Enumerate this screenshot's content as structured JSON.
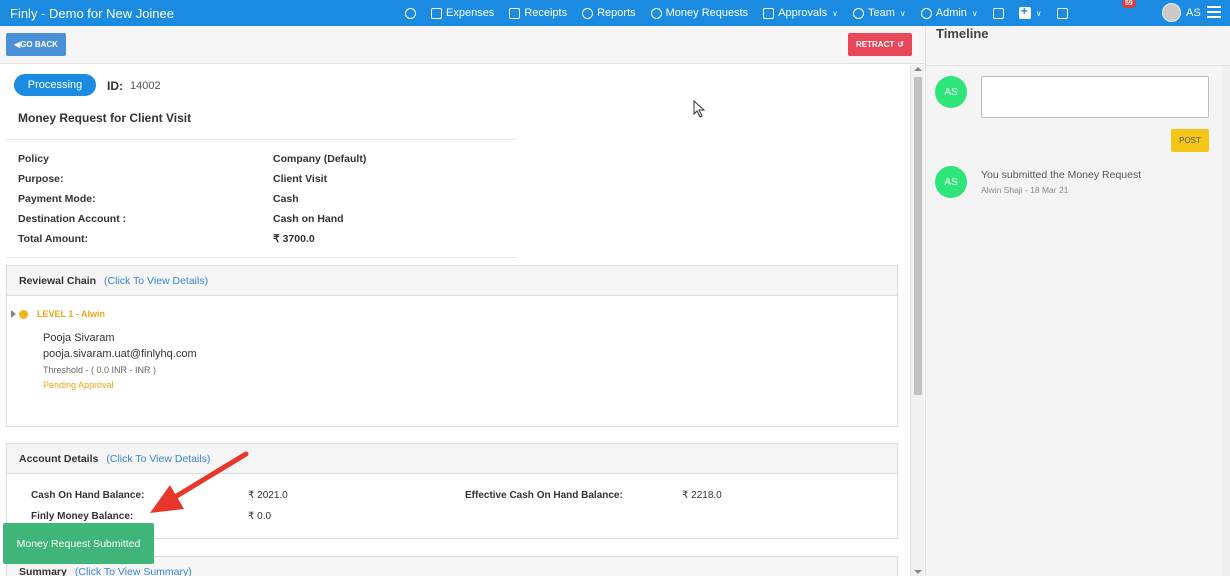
{
  "app": {
    "title": "Finly - Demo for New Joinee"
  },
  "nav": {
    "expenses": "Expenses",
    "receipts": "Receipts",
    "reports": "Reports",
    "money_requests": "Money Requests",
    "approvals": "Approvals",
    "team": "Team",
    "admin": "Admin",
    "notification_count": "59",
    "user_initials": "AS"
  },
  "toolbar": {
    "back_label": "GO BACK",
    "retract_label": "RETRACT"
  },
  "request": {
    "status": "Processing",
    "id_label": "ID:",
    "id_value": "14002",
    "title": "Money Request for Client Visit"
  },
  "details": [
    {
      "label": "Policy",
      "value": "Company (Default)"
    },
    {
      "label": "Purpose:",
      "value": "Client Visit"
    },
    {
      "label": "Payment Mode:",
      "value": "Cash"
    },
    {
      "label": "Destination Account :",
      "value": "Cash on Hand"
    },
    {
      "label": "Total Amount:",
      "value": "₹ 3700.0"
    }
  ],
  "review_chain": {
    "heading": "Reviewal Chain",
    "link": "(Click To View Details)",
    "level": "LEVEL 1  -  Alwin",
    "reviewer_name": "Pooja Sivaram",
    "reviewer_email": "pooja.sivaram.uat@finlyhq.com",
    "threshold": "Threshold -  ( 0.0 INR - INR )",
    "status": "Pending Approval"
  },
  "account": {
    "heading": "Account Details",
    "link": "(Click To View Details)",
    "cash_label": "Cash On Hand Balance:",
    "cash_value": "₹  2021.0",
    "effective_label": "Effective Cash On Hand Balance:",
    "effective_value": "₹  2218.0",
    "finly_label": "Finly Money Balance:",
    "finly_value": "₹  0.0"
  },
  "summary": {
    "heading": "Summary",
    "link": "(Click To View Summary)"
  },
  "toast": "Money Request Submitted",
  "timeline": {
    "title": "Timeline",
    "avatar": "AS",
    "post_label": "POST",
    "entry_text": "You submitted the Money Request",
    "entry_meta": "Alwin Shaji - 18 Mar 21"
  },
  "colors": {
    "primary": "#1a8be0",
    "retract": "#e8485a",
    "pending": "#e6a817",
    "toast": "#3fb57a",
    "avatar": "#2ee57a",
    "post": "#f5c518"
  }
}
